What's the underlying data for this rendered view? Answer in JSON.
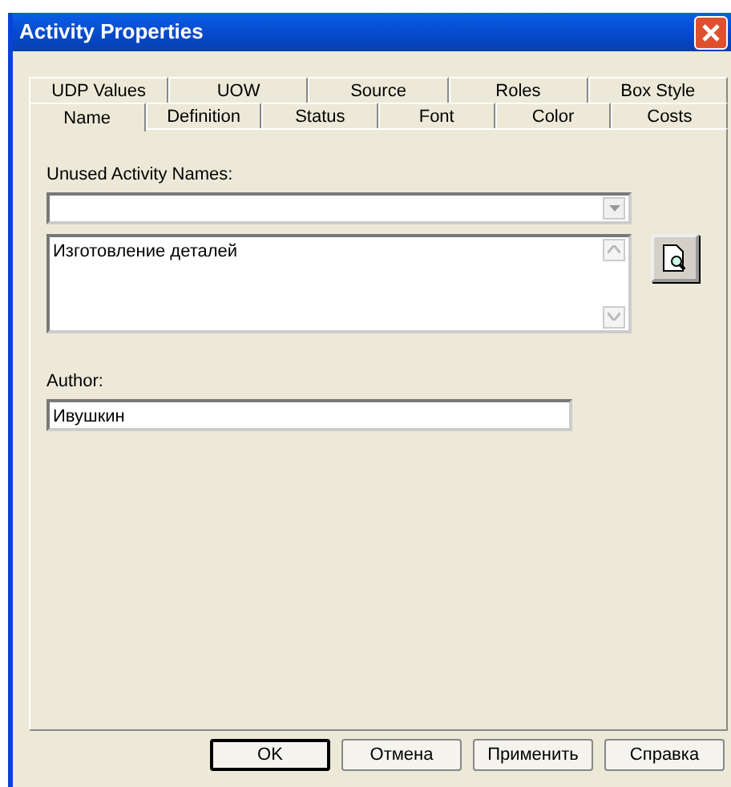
{
  "window": {
    "title": "Activity Properties"
  },
  "tab_rows": [
    [
      {
        "label": "UDP Values",
        "selected": false
      },
      {
        "label": "UOW",
        "selected": false
      },
      {
        "label": "Source",
        "selected": false
      },
      {
        "label": "Roles",
        "selected": false
      },
      {
        "label": "Box Style",
        "selected": false
      }
    ],
    [
      {
        "label": "Name",
        "selected": true
      },
      {
        "label": "Definition",
        "selected": false
      },
      {
        "label": "Status",
        "selected": false
      },
      {
        "label": "Font",
        "selected": false
      },
      {
        "label": "Color",
        "selected": false
      },
      {
        "label": "Costs",
        "selected": false
      }
    ]
  ],
  "unused_names": {
    "label": "Unused Activity Names:"
  },
  "name_text": {
    "value": "Изготовление деталей"
  },
  "author": {
    "label": "Author:",
    "value": "Ивушкин"
  },
  "buttons": [
    {
      "label": "OK",
      "default": true
    },
    {
      "label": "Отмена",
      "default": false
    },
    {
      "label": "Применить",
      "default": false
    },
    {
      "label": "Справка",
      "default": false
    }
  ]
}
